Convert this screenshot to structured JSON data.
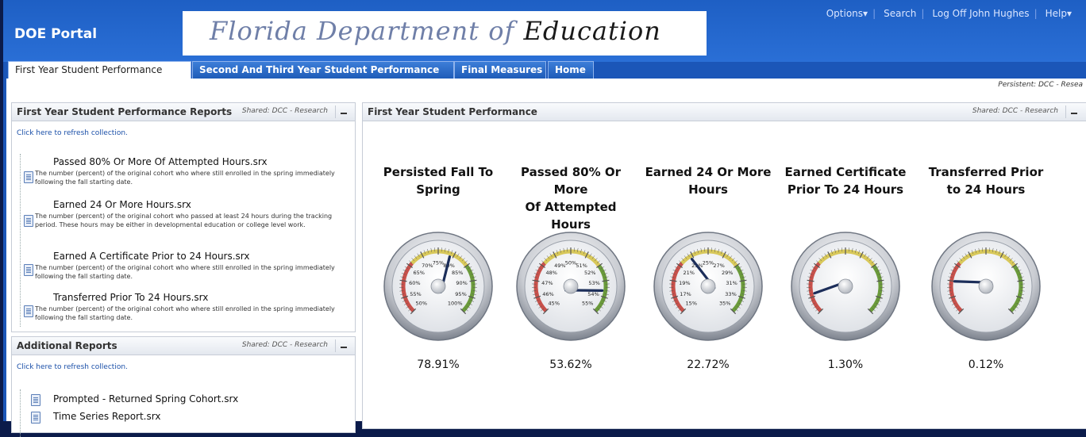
{
  "header": {
    "brand": "DOE Portal",
    "banner_title_light": "Florida Department of",
    "banner_title_dark": "Education",
    "links": [
      "Options▾",
      "Search",
      "Log Off John Hughes",
      "Help▾"
    ]
  },
  "tabs": [
    {
      "label": "First Year Student Performance",
      "active": true
    },
    {
      "label": "Second And Third Year Student Performance",
      "active": false
    },
    {
      "label": "Final Measures",
      "active": false
    },
    {
      "label": "Home",
      "active": false
    }
  ],
  "persistent_label": "Persistent: DCC - Resea",
  "left_panel": {
    "title": "First Year Student Performance Reports",
    "shared": "Shared: DCC - Research",
    "refresh": "Click here to refresh collection.",
    "reports": [
      {
        "title": "Passed 80% Or More Of Attempted Hours.srx",
        "desc": "The number (percent) of the original cohort who where still enrolled in the spring immediately following the fall starting date."
      },
      {
        "title": "Earned 24 Or More Hours.srx",
        "desc": "The number (percent) of the original cohort who passed at least 24 hours during the tracking period. These hours may be either in developmental education or college level work."
      },
      {
        "title": "Earned A Certificate Prior to 24 Hours.srx",
        "desc": "The number (percent) of the original cohort who where still enrolled in the spring immediately following the fall starting date."
      },
      {
        "title": "Transferred Prior To 24 Hours.srx",
        "desc": "The number (percent) of the original cohort who where still enrolled in the spring immediately following the fall starting date."
      }
    ]
  },
  "additional_panel": {
    "title": "Additional Reports",
    "shared": "Shared: DCC - Research",
    "refresh": "Click here to refresh collection.",
    "reports": [
      "Prompted - Returned Spring Cohort.srx",
      "Time Series Report.srx"
    ]
  },
  "main_panel": {
    "title": "First Year Student Performance",
    "shared": "Shared: DCC - Research",
    "gauges": [
      {
        "title_1": "Persisted Fall To",
        "title_2": "Spring",
        "value": "78.91%",
        "ticks": [
          "50%",
          "55%",
          "60%",
          "65%",
          "70%",
          "75%",
          "80%",
          "85%",
          "90%",
          "95%",
          "100%"
        ],
        "needle": 0.5782
      },
      {
        "title_1": "Passed 80% Or More",
        "title_2": "Of Attempted Hours",
        "value": "53.62%",
        "ticks": [
          "45%",
          "46%",
          "47%",
          "48%",
          "49%",
          "50%",
          "51%",
          "52%",
          "53%",
          "54%",
          "55%"
        ],
        "needle": 0.862
      },
      {
        "title_1": "Earned 24 Or More",
        "title_2": "Hours",
        "value": "22.72%",
        "ticks": [
          "15%",
          "17%",
          "19%",
          "21%",
          "23%",
          "25%",
          "27%",
          "29%",
          "31%",
          "33%",
          "35%"
        ],
        "needle": 0.386
      },
      {
        "title_1": "Earned Certificate",
        "title_2": "Prior To 24 Hours",
        "value": "1.30%",
        "ticks": [],
        "needle": 0.12
      },
      {
        "title_1": "Transferred Prior",
        "title_2": "to 24 Hours",
        "value": "0.12%",
        "ticks": [],
        "needle": 0.2
      }
    ]
  },
  "colors": {
    "header_blue": "#1e5fc4",
    "zone_red": "#c8504a",
    "zone_yellow": "#d8c85a",
    "zone_green": "#6a9a3a",
    "needle": "#1c2e5a"
  }
}
